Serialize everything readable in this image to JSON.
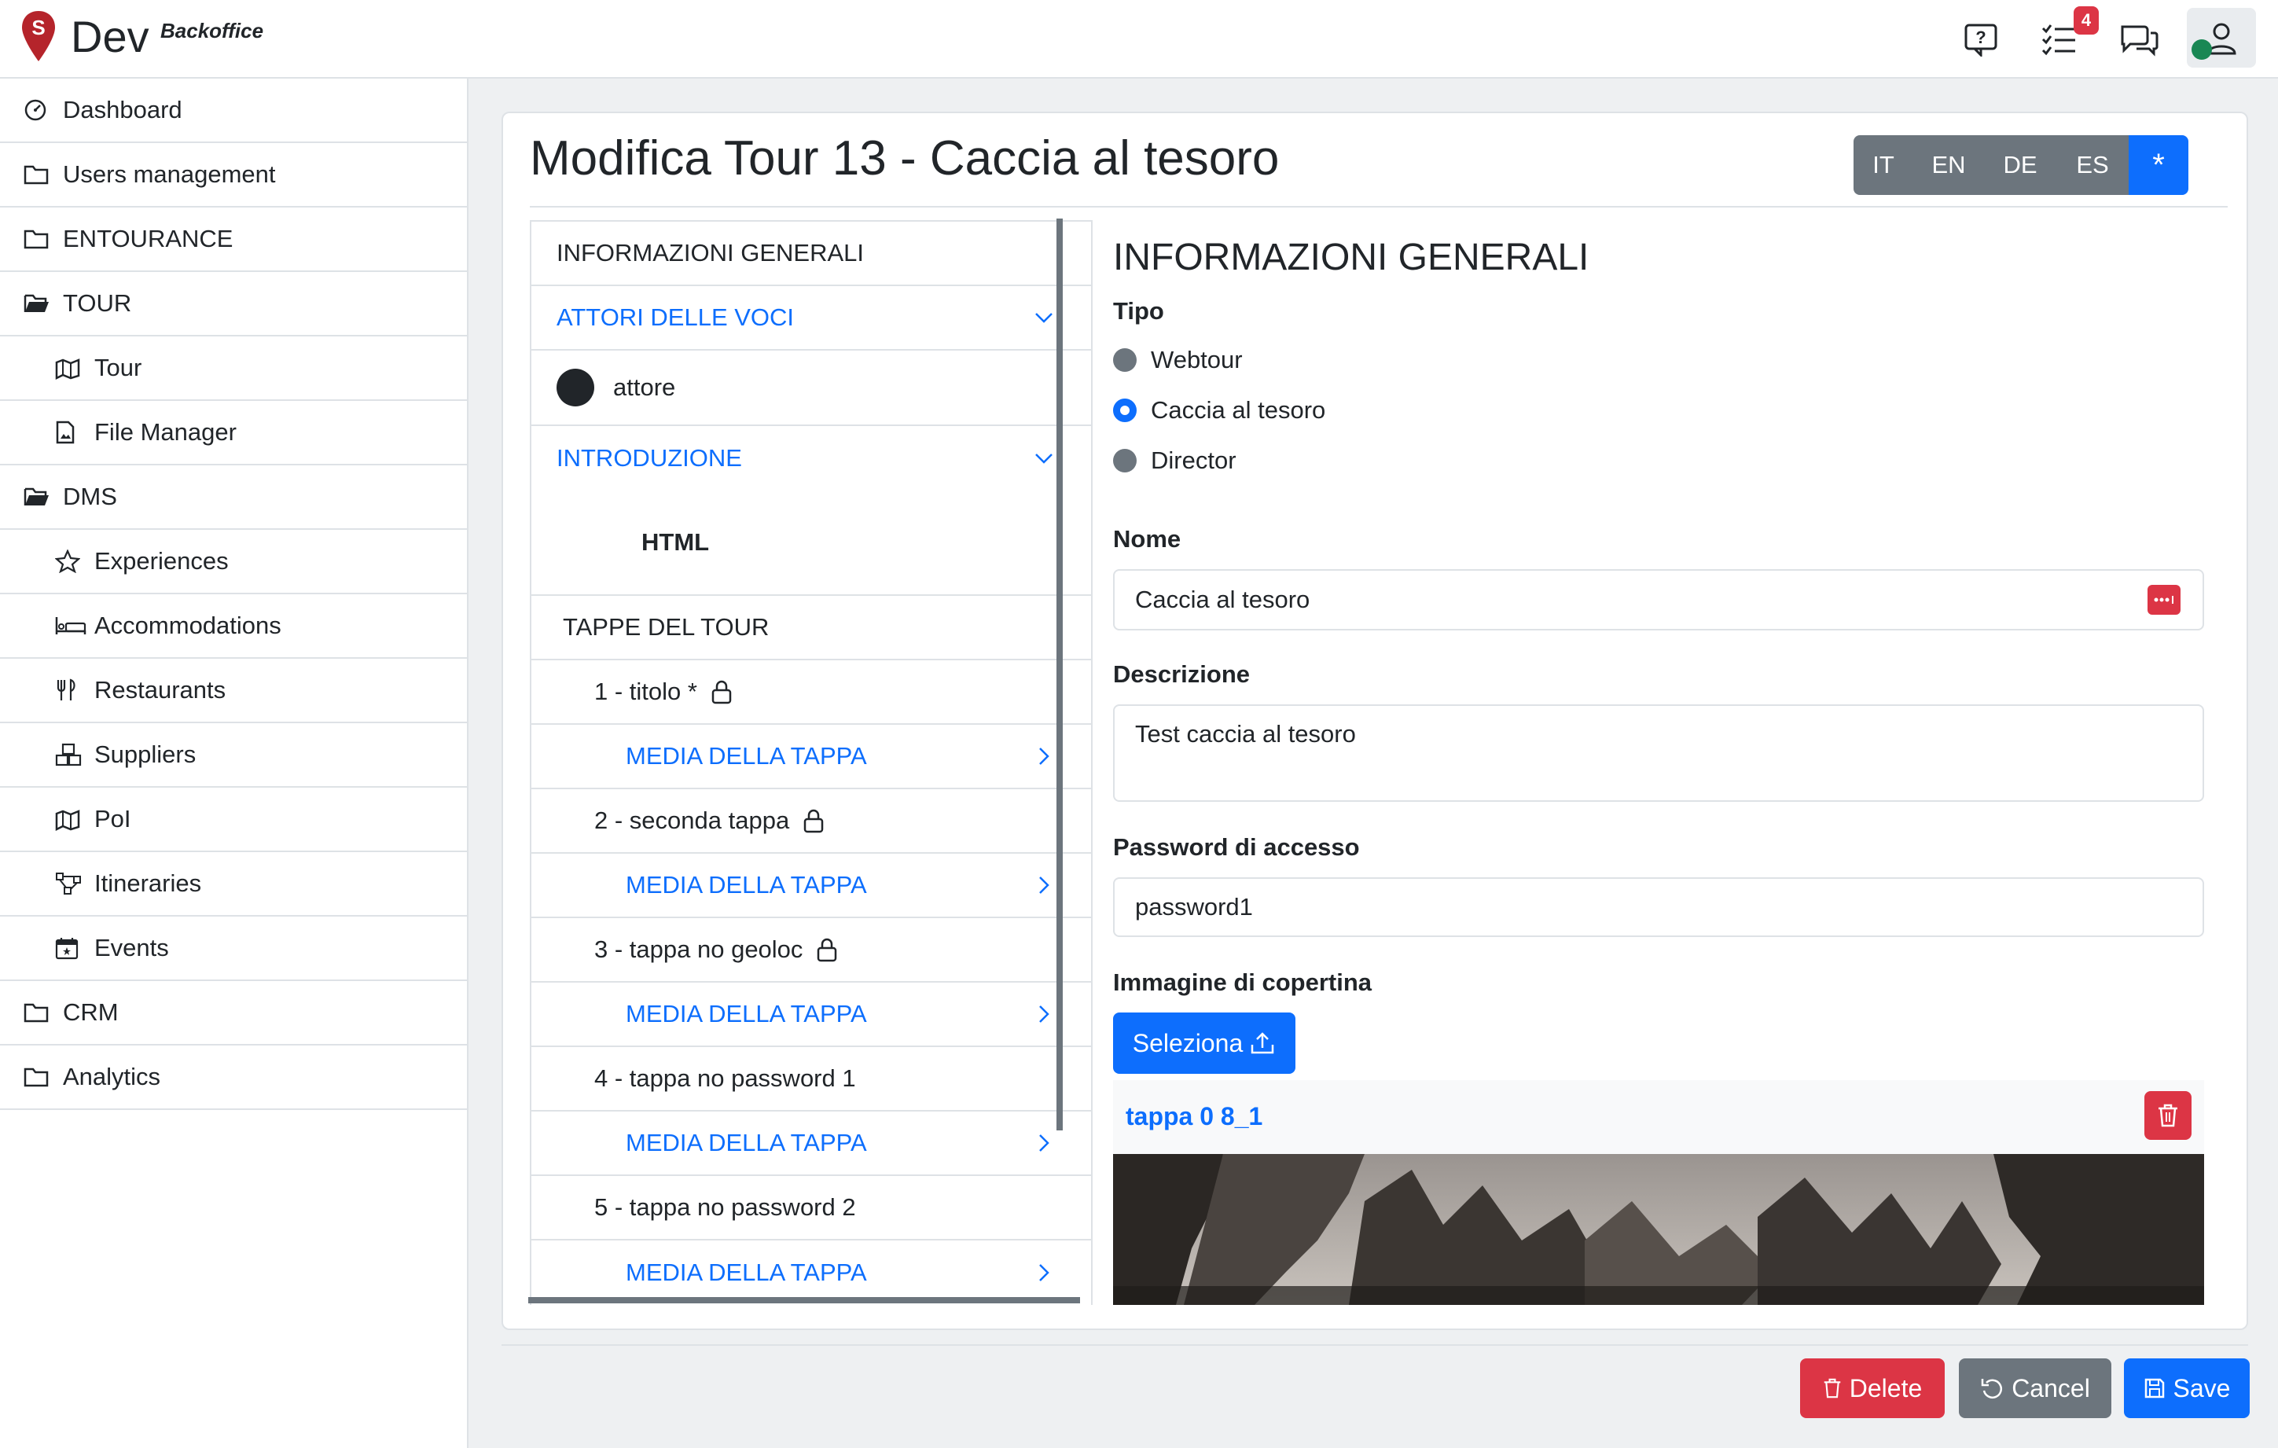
{
  "header": {
    "brand_name": "Dev",
    "brand_sub": "Backoffice",
    "task_count": "4",
    "icons": [
      "help-icon",
      "tasks-icon",
      "chat-icon",
      "user-icon"
    ]
  },
  "sidebar": {
    "items": [
      {
        "label": "Dashboard",
        "icon": "speedometer-icon",
        "level": 0
      },
      {
        "label": "Users management",
        "icon": "folder-icon",
        "level": 0
      },
      {
        "label": "ENTOURANCE",
        "icon": "folder-icon",
        "level": 0
      },
      {
        "label": "TOUR",
        "icon": "folder-open-icon",
        "level": 0
      },
      {
        "label": "Tour",
        "icon": "map-icon",
        "level": 1
      },
      {
        "label": "File Manager",
        "icon": "file-image-icon",
        "level": 1
      },
      {
        "label": "DMS",
        "icon": "folder-open-icon",
        "level": 0
      },
      {
        "label": "Experiences",
        "icon": "star-icon",
        "level": 1
      },
      {
        "label": "Accommodations",
        "icon": "bed-icon",
        "level": 1
      },
      {
        "label": "Restaurants",
        "icon": "fork-knife-icon",
        "level": 1
      },
      {
        "label": "Suppliers",
        "icon": "boxes-icon",
        "level": 1
      },
      {
        "label": "PoI",
        "icon": "map-icon",
        "level": 1
      },
      {
        "label": "Itineraries",
        "icon": "diagram-icon",
        "level": 1
      },
      {
        "label": "Events",
        "icon": "calendar-icon",
        "level": 1
      },
      {
        "label": "CRM",
        "icon": "folder-icon",
        "level": 0
      },
      {
        "label": "Analytics",
        "icon": "folder-icon",
        "level": 0
      }
    ]
  },
  "page": {
    "title": "Modifica Tour 13 - Caccia al tesoro",
    "languages": [
      "IT",
      "EN",
      "DE",
      "ES",
      "*"
    ]
  },
  "left_panel": {
    "general_info": "INFORMAZIONI GENERALI",
    "actors_header": "ATTORI DELLE VOCI",
    "actor_name": "attore",
    "intro_header": "INTRODUZIONE",
    "html_label": "HTML",
    "stages_header": "TAPPE DEL TOUR",
    "stages": [
      {
        "label": "1 - titolo *",
        "locked": true,
        "media": "MEDIA DELLA TAPPA"
      },
      {
        "label": "2 - seconda tappa",
        "locked": true,
        "media": "MEDIA DELLA TAPPA"
      },
      {
        "label": "3 - tappa no geoloc",
        "locked": true,
        "media": "MEDIA DELLA TAPPA"
      },
      {
        "label": "4 - tappa no password 1",
        "locked": false,
        "media": "MEDIA DELLA TAPPA"
      },
      {
        "label": "5 - tappa no password 2",
        "locked": false,
        "media": "MEDIA DELLA TAPPA"
      }
    ]
  },
  "form": {
    "section_title": "INFORMAZIONI GENERALI",
    "tipo_label": "Tipo",
    "tipo_options": [
      "Webtour",
      "Caccia al tesoro",
      "Director"
    ],
    "tipo_selected": "Caccia al tesoro",
    "nome_label": "Nome",
    "nome_value": "Caccia al tesoro",
    "descrizione_label": "Descrizione",
    "descrizione_value": "Test caccia al tesoro",
    "password_label": "Password di accesso",
    "password_value": "password1",
    "cover_label": "Immagine di copertina",
    "select_button": "Seleziona",
    "image_name": "tappa 0 8_1"
  },
  "footer": {
    "delete": "Delete",
    "cancel": "Cancel",
    "save": "Save"
  },
  "colors": {
    "primary": "#0d6efd",
    "danger": "#dc3545",
    "secondary": "#6c757d",
    "brand": "#b5242b"
  }
}
